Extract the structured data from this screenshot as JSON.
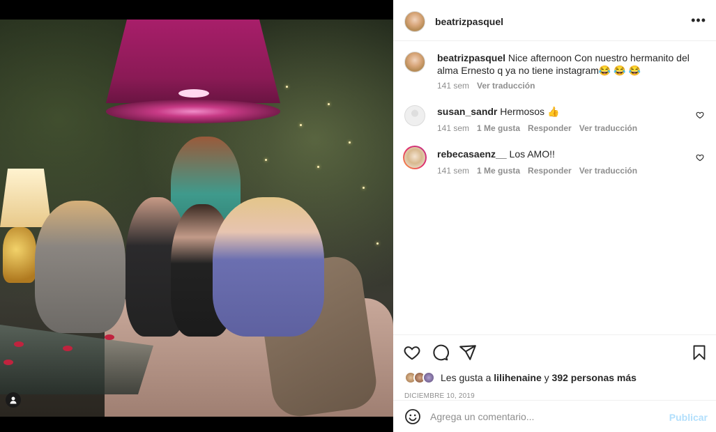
{
  "post": {
    "author": "beatrizpasquel",
    "caption": "Nice afternoon Con nuestro hermanito del alma Ernesto q ya no tiene instagram😂 😂 😂",
    "caption_age": "141 sem",
    "caption_translate": "Ver traducción"
  },
  "comments": [
    {
      "username": "susan_sandr",
      "text": "Hermosos 👍",
      "age": "141 sem",
      "likes": "1 Me gusta",
      "reply": "Responder",
      "translate": "Ver traducción"
    },
    {
      "username": "rebecasaenz__",
      "text": "Los AMO!!",
      "age": "141 sem",
      "likes": "1 Me gusta",
      "reply": "Responder",
      "translate": "Ver traducción"
    }
  ],
  "likes": {
    "prefix": "Les gusta a",
    "user": "lilihenaine",
    "connector": "y",
    "others": "392 personas más"
  },
  "date": "DICIEMBRE 10, 2019",
  "add_comment": {
    "placeholder": "Agrega un comentario...",
    "publish": "Publicar"
  },
  "colors": {
    "link_blue_disabled": "#b2dffc",
    "secondary_text": "#8e8e8e",
    "primary_text": "#262626"
  }
}
